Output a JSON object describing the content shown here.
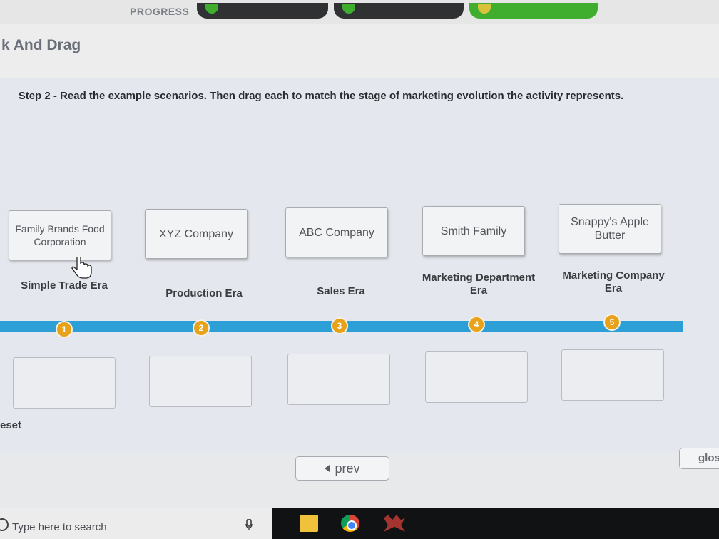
{
  "header": {
    "progress_label": "PROGRESS",
    "title": "k And Drag"
  },
  "instruction": "Step 2 - Read the example scenarios. Then drag each to match the stage of marketing evolution the activity represents.",
  "scenario_cards": [
    {
      "label": "Family Brands Food Corporation"
    },
    {
      "label": "XYZ Company"
    },
    {
      "label": "ABC Company"
    },
    {
      "label": "Smith Family"
    },
    {
      "label": "Snappy's Apple Butter"
    }
  ],
  "eras": [
    {
      "label": "Simple Trade Era",
      "number": "1"
    },
    {
      "label": "Production Era",
      "number": "2"
    },
    {
      "label": "Sales Era",
      "number": "3"
    },
    {
      "label": "Marketing Department Era",
      "number": "4"
    },
    {
      "label": "Marketing Company Era",
      "number": "5"
    }
  ],
  "controls": {
    "reset_label": "eset",
    "prev_label": "prev",
    "glossary_label": "glos"
  },
  "taskbar": {
    "search_placeholder": "Type here to search"
  },
  "colors": {
    "timeline": "#2c9fd6",
    "marker": "#e7a21a",
    "progress_complete": "#3fae2f"
  }
}
